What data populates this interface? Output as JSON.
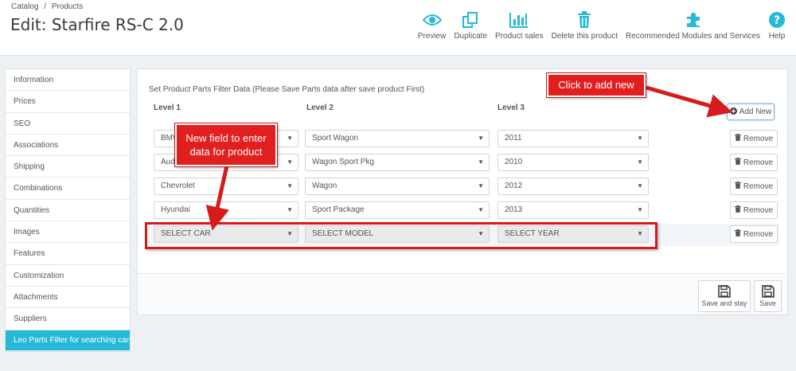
{
  "breadcrumb": [
    "Catalog",
    "/",
    "Products"
  ],
  "page_title": "Edit: Starfire RS-C 2.0",
  "toolbar": [
    {
      "label": "Preview",
      "icon": "eye-icon"
    },
    {
      "label": "Duplicate",
      "icon": "copy-icon"
    },
    {
      "label": "Product sales",
      "icon": "bar-chart-icon"
    },
    {
      "label": "Delete this product",
      "icon": "trash-icon"
    },
    {
      "label": "Recommended Modules and Services",
      "icon": "puzzle-icon"
    },
    {
      "label": "Help",
      "icon": "help-icon"
    }
  ],
  "sidebar": {
    "items": [
      {
        "label": "Information"
      },
      {
        "label": "Prices"
      },
      {
        "label": "SEO"
      },
      {
        "label": "Associations"
      },
      {
        "label": "Shipping"
      },
      {
        "label": "Combinations"
      },
      {
        "label": "Quantities"
      },
      {
        "label": "Images"
      },
      {
        "label": "Features"
      },
      {
        "label": "Customization"
      },
      {
        "label": "Attachments"
      },
      {
        "label": "Suppliers"
      },
      {
        "label": "Leo Parts Filter for searching cars"
      }
    ]
  },
  "panel": {
    "heading": "Set Product Parts Filter Data (Please Save Parts data after save product First)",
    "level1": "Level 1",
    "level2": "Level 2",
    "level3": "Level 3",
    "add_new": "Add New",
    "remove": "Remove",
    "rows": [
      {
        "car": "BMW",
        "model": "Sport Wagon",
        "year": "2011"
      },
      {
        "car": "Audi",
        "model": "Wagon Sport Pkg",
        "year": "2010"
      },
      {
        "car": "Chevrolet",
        "model": "Wagon",
        "year": "2012"
      },
      {
        "car": "Hyundai",
        "model": "Sport Package",
        "year": "2013"
      },
      {
        "car": "SELECT CAR",
        "model": "SELECT MODEL",
        "year": "SELECT YEAR"
      }
    ],
    "save_and_stay": "Save and stay",
    "save": "Save"
  },
  "annotations": {
    "add_new_callout": "Click to add new",
    "field_callout": "New field to enter data for product"
  },
  "colors": {
    "accent": "#25b9d7",
    "annotation_red": "#e21f1f",
    "icon_teal": "#25b9d7"
  }
}
